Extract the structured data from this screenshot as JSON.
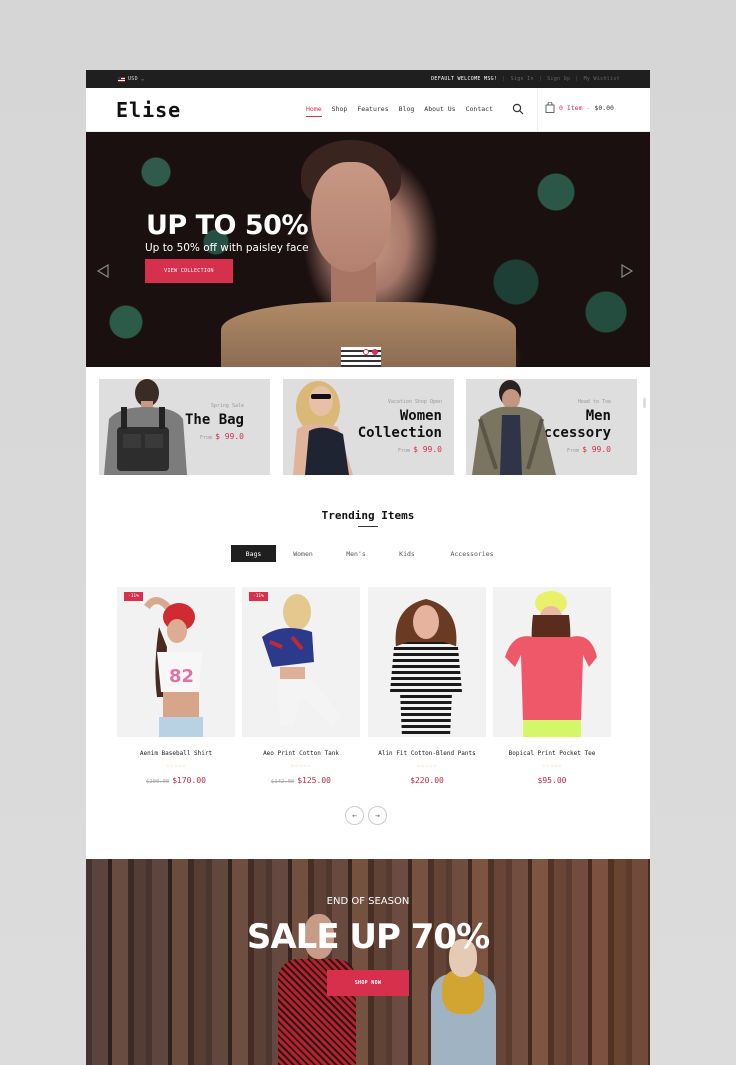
{
  "topbar": {
    "currency": "USD",
    "welcome": "DEFAULT WELCOME MSG!",
    "links": [
      "Sign In",
      "Sign Up",
      "My Wishlist"
    ]
  },
  "header": {
    "logo": "Elise",
    "nav": [
      {
        "label": "Home",
        "active": true
      },
      {
        "label": "Shop",
        "active": false
      },
      {
        "label": "Features",
        "active": false
      },
      {
        "label": "Blog",
        "active": false
      },
      {
        "label": "About Us",
        "active": false
      },
      {
        "label": "Contact",
        "active": false
      }
    ],
    "cart": {
      "count": "0 Item",
      "separator": "-",
      "total": "$0.00"
    }
  },
  "hero": {
    "title": "UP TO 50%",
    "subtitle": "Up to 50% off with paisley face",
    "button": "VIEW COLLECTION",
    "slides": 2,
    "active_slide": 2
  },
  "banners": [
    {
      "kicker": "Spring Sale",
      "title_lines": [
        "The Bag"
      ],
      "from": "From",
      "price": "$ 99.0"
    },
    {
      "kicker": "Vacation Shop Open",
      "title_lines": [
        "Women",
        "Collection"
      ],
      "from": "From",
      "price": "$ 99.0"
    },
    {
      "kicker": "Head to Toe",
      "title_lines": [
        "Men",
        "Accessory"
      ],
      "from": "From",
      "price": "$ 99.0"
    }
  ],
  "trending": {
    "title": "Trending Items",
    "tabs": [
      {
        "label": "Bags",
        "active": true
      },
      {
        "label": "Women",
        "active": false
      },
      {
        "label": "Men's",
        "active": false
      },
      {
        "label": "Kids",
        "active": false
      },
      {
        "label": "Accessories",
        "active": false
      }
    ],
    "products": [
      {
        "name": "Aenim Baseball Shirt",
        "badge": "-11%",
        "old_price": "$200.00",
        "price": "$170.00",
        "rating": 0
      },
      {
        "name": "Aeo Print Cotton Tank",
        "badge": "-11%",
        "old_price": "$142.00",
        "price": "$125.00",
        "rating": 0
      },
      {
        "name": "Alin Fit Cotton-Blend Pants",
        "badge": "",
        "old_price": "",
        "price": "$220.00",
        "rating": 0
      },
      {
        "name": "Bopical Print Pocket Tee",
        "badge": "",
        "old_price": "",
        "price": "$95.00",
        "rating": 0
      }
    ],
    "pager": {
      "prev": "←",
      "next": "→"
    }
  },
  "sale": {
    "kicker": "END OF SEASON",
    "title": "SALE UP 70%",
    "button": "SHOP NOW"
  },
  "colors": {
    "accent": "#d6304c",
    "dark": "#1f1f1f",
    "banner_bg": "#dedede"
  }
}
